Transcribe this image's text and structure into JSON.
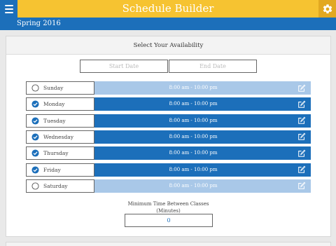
{
  "header": {
    "title": "Schedule Builder",
    "menu_icon": "hamburger-menu-icon",
    "settings_icon": "gear-icon",
    "bar_color": "#f6c331",
    "accent_color": "#1c6fba"
  },
  "term": {
    "label": "Spring 2016"
  },
  "availability": {
    "heading": "Select Your Availability",
    "start_placeholder": "Start Date",
    "end_placeholder": "End Date",
    "days": [
      {
        "name": "Sunday",
        "time": "8:00 am - 10:00 pm",
        "selected": false
      },
      {
        "name": "Monday",
        "time": "8:00 am - 10:00 pm",
        "selected": true
      },
      {
        "name": "Tuesday",
        "time": "8:00 am - 10:00 pm",
        "selected": true
      },
      {
        "name": "Wednesday",
        "time": "8:00 am - 10:00 pm",
        "selected": true
      },
      {
        "name": "Thursday",
        "time": "8:00 am - 10:00 pm",
        "selected": true
      },
      {
        "name": "Friday",
        "time": "8:00 am - 10:00 pm",
        "selected": true
      },
      {
        "name": "Saturday",
        "time": "8:00 am - 10:00 pm",
        "selected": false
      }
    ],
    "min_time_label_line1": "Minimum Time Between Classes",
    "min_time_label_line2": "(Minutes)",
    "min_time_value": "0"
  }
}
